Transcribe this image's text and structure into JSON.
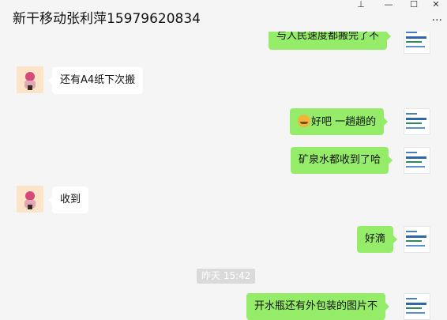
{
  "window": {
    "title": "新干移动张利萍15979620834",
    "pin_icon": "pin-icon",
    "minimize_icon": "minimize-icon",
    "maximize_icon": "maximize-icon",
    "close_icon": "close-icon",
    "more_icon": "more-icon",
    "pin_glyph": "⊥",
    "minimize_glyph": "—",
    "maximize_glyph": "☐",
    "close_glyph": "✕",
    "more_glyph": "···"
  },
  "messages": [
    {
      "side": "right",
      "text": "与人民速度都搬完了不"
    },
    {
      "side": "left",
      "text": "还有A4纸下次搬"
    },
    {
      "side": "right",
      "text": "好吧  一趟趟的",
      "emoji": "grin-emoji"
    },
    {
      "side": "right",
      "text": "矿泉水都收到了哈"
    },
    {
      "side": "left",
      "text": "收到"
    },
    {
      "side": "right",
      "text": "好滴"
    },
    {
      "side": "right",
      "text": "开水瓶还有外包装的图片不"
    }
  ],
  "timestamp": "昨天 15:42",
  "colors": {
    "background": "#f5f5f5",
    "bubble_self": "#95ec69",
    "bubble_other": "#ffffff",
    "timestamp_bg": "#dadada"
  }
}
